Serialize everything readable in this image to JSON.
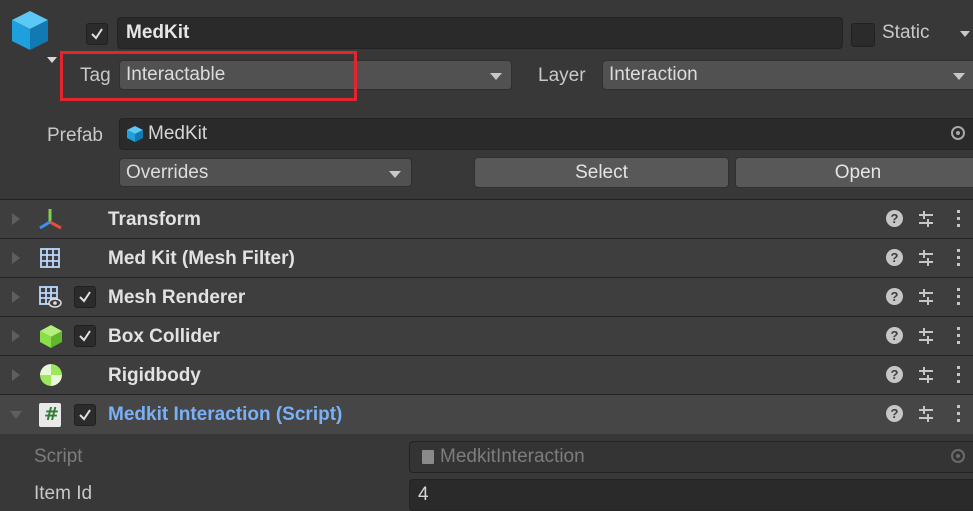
{
  "header": {
    "object_name": "MedKit",
    "static_label": "Static",
    "active": true,
    "static_checked": false
  },
  "tag": {
    "label": "Tag",
    "value": "Interactable"
  },
  "layer": {
    "label": "Layer",
    "value": "Interaction"
  },
  "prefab": {
    "label": "Prefab",
    "asset": "MedKit",
    "overrides_label": "Overrides",
    "select_label": "Select",
    "open_label": "Open"
  },
  "components": [
    {
      "title": "Transform",
      "icon": "transform-icon",
      "has_checkbox": false,
      "expanded": false
    },
    {
      "title": "Med Kit (Mesh Filter)",
      "icon": "mesh-filter-icon",
      "has_checkbox": false,
      "expanded": false
    },
    {
      "title": "Mesh Renderer",
      "icon": "mesh-renderer-icon",
      "has_checkbox": true,
      "expanded": false
    },
    {
      "title": "Box Collider",
      "icon": "box-collider-icon",
      "has_checkbox": true,
      "expanded": false
    },
    {
      "title": "Rigidbody",
      "icon": "rigidbody-icon",
      "has_checkbox": false,
      "expanded": false
    },
    {
      "title": "Medkit Interaction (Script)",
      "icon": "script-icon",
      "has_checkbox": true,
      "expanded": true
    }
  ],
  "script_fields": {
    "script_label": "Script",
    "script_value": "MedkitInteraction",
    "item_id_label": "Item Id",
    "item_id_value": "4"
  },
  "colors": {
    "background": "#383838",
    "field": "#2a2a2a",
    "highlight_box": "#e3262b",
    "script_title": "#7ab0f5",
    "cube_icon": "#1da1e0",
    "collider_green": "#8be04a"
  }
}
